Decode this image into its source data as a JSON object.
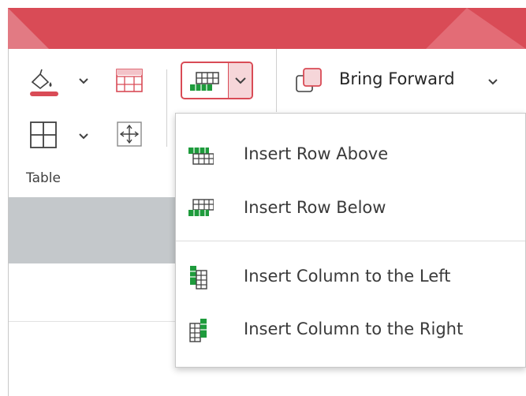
{
  "ribbon": {
    "table_group_label": "Table",
    "bring_forward_label": "Bring Forward"
  },
  "insert_menu": {
    "items": [
      {
        "label": "Insert Row Above",
        "icon": "insert-row-above-icon"
      },
      {
        "label": "Insert Row Below",
        "icon": "insert-row-below-icon"
      },
      {
        "label": "Insert Column to the Left",
        "icon": "insert-column-left-icon"
      },
      {
        "label": "Insert Column to the Right",
        "icon": "insert-column-right-icon"
      }
    ]
  },
  "colors": {
    "accent": "#d94b56",
    "accent_light": "#f6d6d9",
    "icon_green": "#1e9b3c",
    "selection_gray": "#c4c8cb"
  }
}
